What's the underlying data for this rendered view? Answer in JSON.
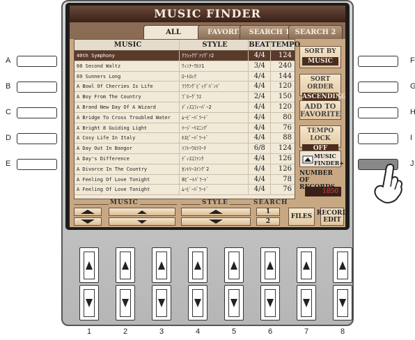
{
  "screen": {
    "title": "MUSIC FINDER",
    "tabs": [
      {
        "label": "ALL",
        "active": true
      },
      {
        "label": "FAVORITE",
        "active": false
      },
      {
        "label": "SEARCH 1",
        "active": false
      },
      {
        "label": "SEARCH 2",
        "active": false
      }
    ],
    "columns": {
      "music": "MUSIC",
      "style": "STYLE",
      "beat": "BEAT",
      "tempo": "TEMPO"
    },
    "rows": [
      {
        "music": "40th Symphony",
        "style": "ｸﾗｼｯｸｳﾞｧｿｳﾞｧ2",
        "beat": "4/4",
        "tempo": "124",
        "selected": true
      },
      {
        "music": "60 Second Waltz",
        "style": "ｳｨﾝﾅｰﾜﾙﾂ1",
        "beat": "3/4",
        "tempo": "240",
        "selected": false
      },
      {
        "music": "69 Sunners Long",
        "style": "ﾛｰﾄﾛｯｸ",
        "beat": "4/4",
        "tempo": "144",
        "selected": false
      },
      {
        "music": "A Bowl Of Cherries Is Life",
        "style": "ﾗﾗｸﾝｸﾞﾋﾞｯｸﾞﾊﾞﾝﾄﾞ",
        "beat": "4/4",
        "tempo": "120",
        "selected": false
      },
      {
        "music": "A Boy From The Country",
        "style": "ﾌﾞﾙｰｸﾞﾗｽ",
        "beat": "2/4",
        "tempo": "150",
        "selected": false
      },
      {
        "music": "A Brand New Day Of A Wizard",
        "style": "ﾃﾞｨｽｺﾌｨｰﾊﾞｰ2",
        "beat": "4/4",
        "tempo": "120",
        "selected": false
      },
      {
        "music": "A Bridge To Cross Troubled Water",
        "style": "ﾑｰﾋﾞｰﾊﾞﾗｰﾄﾞ",
        "beat": "4/4",
        "tempo": "80",
        "selected": false
      },
      {
        "music": "A Bright 8 Guiding Light",
        "style": "ｲｰｼﾞｰﾘｽﾆﾝｸﾞ",
        "beat": "4/4",
        "tempo": "76",
        "selected": false
      },
      {
        "music": "A Cosy Life In Italy",
        "style": "ﾎｽﾋﾟｰﾊﾞﾗｰﾄﾞ",
        "beat": "4/4",
        "tempo": "88",
        "selected": false
      },
      {
        "music": "A Day Out In Bangor",
        "style": "ｿﾌﾄｰﾜﾙﾂﾏｰﾁ",
        "beat": "6/8",
        "tempo": "124",
        "selected": false
      },
      {
        "music": "A Day's Difference",
        "style": "ﾃﾞｨｽｺﾌｧﾝｸ",
        "beat": "4/4",
        "tempo": "126",
        "selected": false
      },
      {
        "music": "A Divorce In The Country",
        "style": "ｶﾝﾄﾘｰｽｲﾝｸﾞ2",
        "beat": "4/4",
        "tempo": "126",
        "selected": false
      },
      {
        "music": "A Feeling Of Love Tonight",
        "style": "8ﾋﾞｰﾄﾊﾞﾗｰﾄﾞ",
        "beat": "4/4",
        "tempo": "78",
        "selected": false
      },
      {
        "music": "A Feeling Of Love Tonight",
        "style": "ﾑｰﾋﾞｰﾊﾞﾗｰﾄﾞ",
        "beat": "4/4",
        "tempo": "76",
        "selected": false
      }
    ],
    "sort_by": {
      "label": "SORT BY",
      "value": "MUSIC"
    },
    "sort_order": {
      "label": "SORT ORDER",
      "value": "ASCENDING"
    },
    "add_to_favorite": "ADD TO FAVORITE",
    "tempo_lock": {
      "label": "TEMPO LOCK",
      "value": "OFF"
    },
    "music_finder_plus": "MUSIC FINDER+",
    "records": {
      "label": "NUMBER OF RECORDS",
      "value": "1850"
    },
    "bottom": {
      "music_label": "MUSIC",
      "style_label": "STYLE",
      "search_label": "SEARCH",
      "search_1": "1",
      "search_2": "2",
      "files": "FILES",
      "record_edit": "RECORD EDIT"
    }
  },
  "left_buttons": [
    "A",
    "B",
    "C",
    "D",
    "E"
  ],
  "right_buttons": [
    "F",
    "G",
    "H",
    "I",
    "J"
  ],
  "bottom_numbers": [
    "1",
    "2",
    "3",
    "4",
    "5",
    "6",
    "7",
    "8"
  ]
}
